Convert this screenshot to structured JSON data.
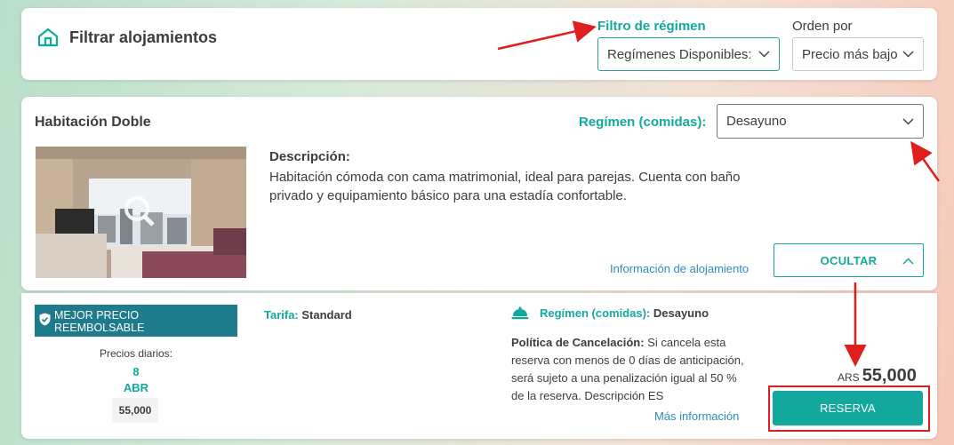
{
  "filter": {
    "title": "Filtrar alojamientos",
    "regimen_label": "Filtro de régimen",
    "regimen_value": "Regímenes Disponibles:",
    "order_label": "Orden por",
    "order_value": "Precio más bajo"
  },
  "room": {
    "title": "Habitación Doble",
    "regimen_label": "Regímen (comidas):",
    "regimen_value": "Desayuno",
    "desc_title": "Descripción:",
    "desc_text": "Habitación cómoda con cama matrimonial, ideal para parejas. Cuenta con baño privado y equipamiento básico para una estadía confortable.",
    "info_link": "Información de alojamiento",
    "hide_button": "OCULTAR"
  },
  "rate": {
    "badge": "MEJOR PRECIO REEMBOLSABLE",
    "daily_label": "Precios diarios:",
    "daily_day": "8",
    "daily_month": "ABR",
    "daily_price": "55,000",
    "tarifa_label": "Tarifa:",
    "tarifa_value": "Standard",
    "regimen_label": "Regímen (comidas):",
    "regimen_value": "Desayuno",
    "policy_label": "Política de Cancelación:",
    "policy_text": "Si cancela esta reserva con menos de 0 días de anticipación, será sujeto a una penalización igual al 50 % de la reserva. Descripción ES",
    "more_link": "Más información",
    "currency": "ARS",
    "amount": "55,000",
    "reserve_button": "RESERVA"
  },
  "colors": {
    "accent": "#13a89e",
    "badge": "#1d7b8c",
    "link": "#2a8fb8",
    "annotation": "#e01e1e"
  }
}
